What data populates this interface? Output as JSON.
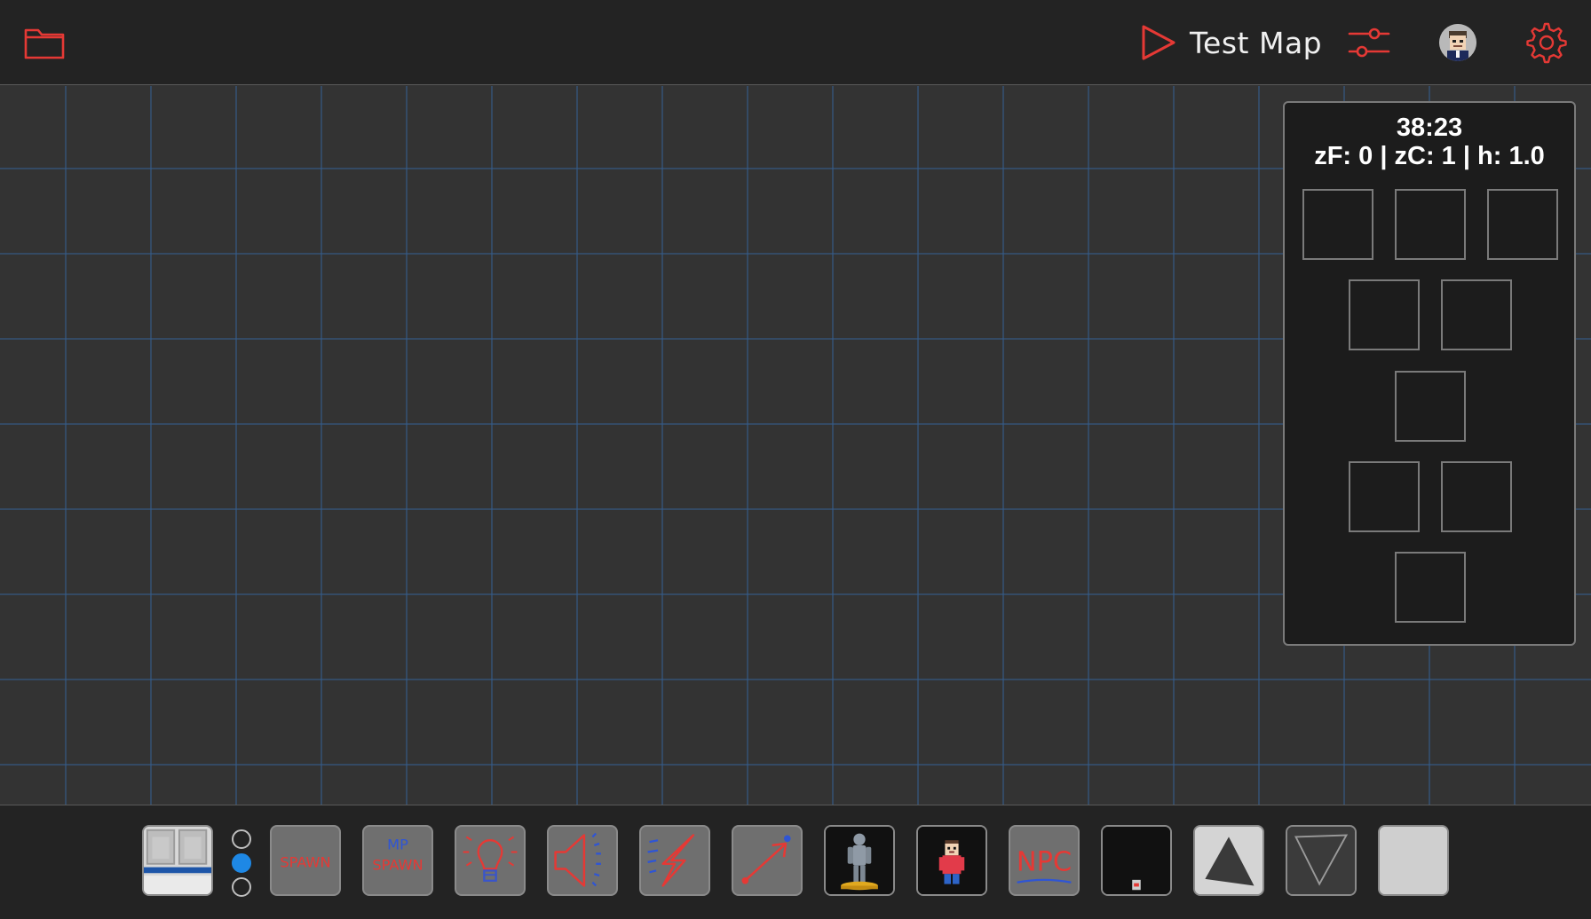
{
  "header": {
    "folder_icon": "folder-icon",
    "play_icon": "play-icon",
    "play_label": "Test Map",
    "sliders_icon": "sliders-icon",
    "avatar_icon": "user-avatar",
    "gear_icon": "gear-icon",
    "accent": "#e53935"
  },
  "info_panel": {
    "time": "38:23",
    "status": "zF: 0 | zC: 1 | h: 1.0",
    "slots_count": 9
  },
  "toolbar": {
    "radio_options": 3,
    "radio_selected": 1,
    "tools": [
      {
        "name": "tile-palette-tool",
        "icon": "tile-palette-icon"
      },
      {
        "name": "spawn-tool",
        "text": "SPAWN",
        "icon": "spawn-icon"
      },
      {
        "name": "mp-spawn-tool",
        "text_top": "MP",
        "text_bottom": "SPAWN",
        "icon": "mp-spawn-icon"
      },
      {
        "name": "light-tool",
        "icon": "lightbulb-icon"
      },
      {
        "name": "sound-tool",
        "icon": "speaker-icon"
      },
      {
        "name": "trigger-tool",
        "icon": "lightning-icon"
      },
      {
        "name": "path-tool",
        "icon": "arrow-path-icon"
      },
      {
        "name": "statue-tool",
        "icon": "statue-icon"
      },
      {
        "name": "player-tool",
        "icon": "player-character-icon"
      },
      {
        "name": "npc-tool",
        "text": "NPC",
        "icon": "npc-icon"
      },
      {
        "name": "small-object-tool",
        "icon": "small-object-icon"
      },
      {
        "name": "triangle-up-tool",
        "icon": "triangle-up-icon"
      },
      {
        "name": "triangle-down-tool",
        "icon": "triangle-down-icon"
      },
      {
        "name": "blank-tile-tool",
        "icon": "blank-tile-icon"
      }
    ]
  }
}
